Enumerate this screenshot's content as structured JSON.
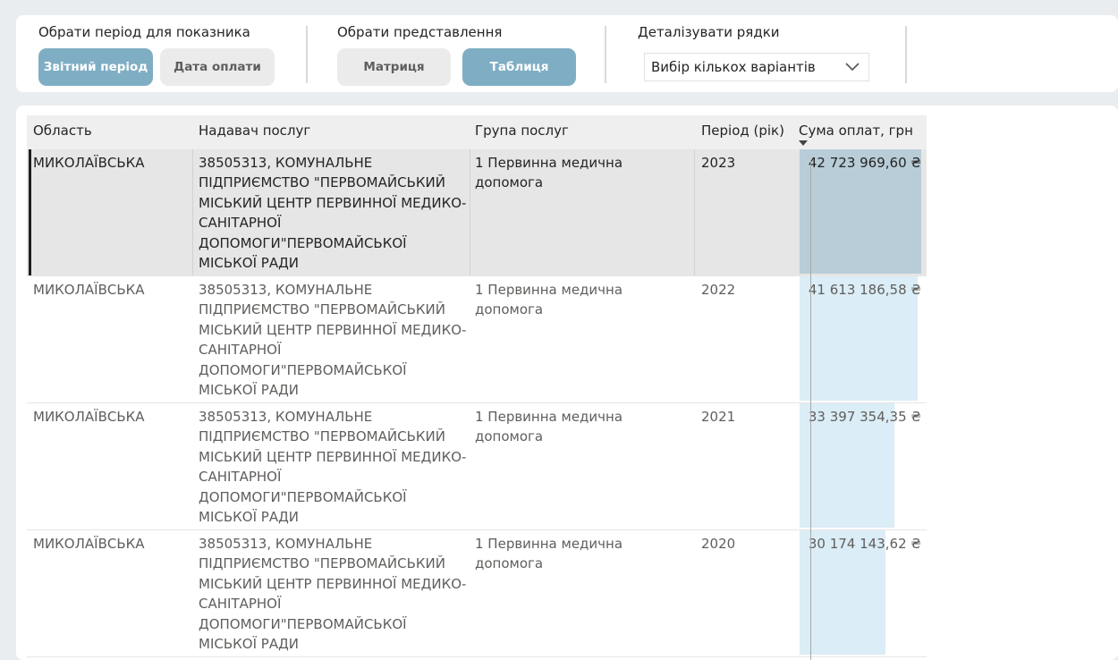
{
  "filters": {
    "period": {
      "title": "Обрати період для показника",
      "options": [
        {
          "label": "Звітний період",
          "active": true
        },
        {
          "label": "Дата оплати",
          "active": false
        }
      ]
    },
    "view": {
      "title": "Обрати представлення",
      "options": [
        {
          "label": "Матриця",
          "active": false
        },
        {
          "label": "Таблиця",
          "active": true
        }
      ]
    },
    "detail": {
      "title": "Деталізувати рядки",
      "dropdown_value": "Вибір кількох варіантів"
    }
  },
  "table": {
    "columns": [
      "Область",
      "Надавач послуг",
      "Група послуг",
      "Період (рік)",
      "Сума оплат, грн"
    ],
    "sort_column": "Сума оплат, грн",
    "sort_direction": "descending",
    "max_value": 42723969.6,
    "rows": [
      {
        "oblast": "МИКОЛАЇВСЬКА",
        "provider": "38505313, КОМУНАЛЬНЕ ПІДПРИЄМСТВО \"ПЕРВОМАЙСЬКИЙ МІСЬКИЙ ЦЕНТР ПЕРВИННОЇ МЕДИКО-САНІТАРНОЇ ДОПОМОГИ\"ПЕРВОМАЙСЬКОЇ МІСЬКОЇ РАДИ",
        "group": "1 Первинна медична допомога",
        "period": "2023",
        "sum": "42 723 969,60 ₴",
        "sum_value": 42723969.6,
        "selected": true
      },
      {
        "oblast": "МИКОЛАЇВСЬКА",
        "provider": "38505313, КОМУНАЛЬНЕ ПІДПРИЄМСТВО \"ПЕРВОМАЙСЬКИЙ МІСЬКИЙ ЦЕНТР ПЕРВИННОЇ МЕДИКО-САНІТАРНОЇ ДОПОМОГИ\"ПЕРВОМАЙСЬКОЇ МІСЬКОЇ РАДИ",
        "group": "1 Первинна медична допомога",
        "period": "2022",
        "sum": "41 613 186,58 ₴",
        "sum_value": 41613186.58,
        "selected": false
      },
      {
        "oblast": "МИКОЛАЇВСЬКА",
        "provider": "38505313, КОМУНАЛЬНЕ ПІДПРИЄМСТВО \"ПЕРВОМАЙСЬКИЙ МІСЬКИЙ ЦЕНТР ПЕРВИННОЇ МЕДИКО-САНІТАРНОЇ ДОПОМОГИ\"ПЕРВОМАЙСЬКОЇ МІСЬКОЇ РАДИ",
        "group": "1 Первинна медична допомога",
        "period": "2021",
        "sum": "33 397 354,35 ₴",
        "sum_value": 33397354.35,
        "selected": false
      },
      {
        "oblast": "МИКОЛАЇВСЬКА",
        "provider": "38505313, КОМУНАЛЬНЕ ПІДПРИЄМСТВО \"ПЕРВОМАЙСЬКИЙ МІСЬКИЙ ЦЕНТР ПЕРВИННОЇ МЕДИКО-САНІТАРНОЇ ДОПОМОГИ\"ПЕРВОМАЙСЬКОЇ МІСЬКОЇ РАДИ",
        "group": "1 Первинна медична допомога",
        "period": "2020",
        "sum": "30 174 143,62 ₴",
        "sum_value": 30174143.62,
        "selected": false
      }
    ]
  },
  "colors": {
    "active_pill": "#7faec4",
    "inactive_pill": "#ebebeb",
    "databar": "#dbedf6",
    "databar_selected": "#b8cdd8"
  },
  "icons": {
    "dropdown": "chevron-down-icon",
    "sort": "sort-descending-icon"
  }
}
